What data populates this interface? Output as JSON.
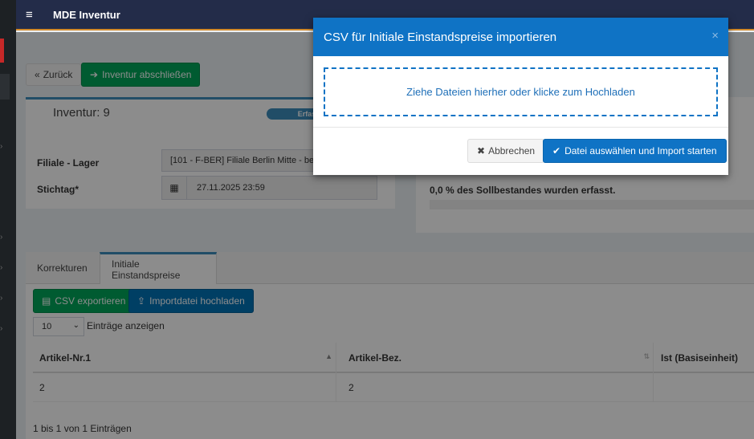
{
  "header": {
    "menu_icon": "hamburger-icon",
    "title": "MDE Inventur"
  },
  "toolbar": {
    "back_label": "Zurück",
    "finish_label": "Inventur abschließen"
  },
  "inventory": {
    "title": "Inventur: 9",
    "status_badge": "Erfas",
    "branch_label": "Filiale - Lager",
    "branch_value": "[101 - F-BER] Filiale Berlin Mitte - be",
    "date_label": "Stichtag*",
    "date_value": "27.11.2025 23:59"
  },
  "progress": {
    "text": "0,0 % des Sollbestandes wurden erfasst.",
    "fraction": 0.0
  },
  "tabs": [
    "Korrekturen",
    "Initiale Einstandspreise"
  ],
  "actions": {
    "export_label": "CSV exportieren",
    "upload_label": "Importdatei hochladen"
  },
  "page_length": {
    "selected": "10",
    "suffix": "Einträge anzeigen"
  },
  "table": {
    "columns": [
      "Artikel-Nr.1",
      "Artikel-Bez.",
      "Ist (Basiseinheit)"
    ],
    "rows": [
      [
        "2",
        "2",
        ""
      ]
    ],
    "info": "1 bis 1 von 1 Einträgen"
  },
  "modal": {
    "title": "CSV für Initiale Einstandspreise importieren",
    "close": "×",
    "dropzone": "Ziehe Dateien hierher oder klicke zum Hochladen",
    "cancel_label": "Abbrechen",
    "confirm_label": "Datei auswählen und Import starten"
  },
  "colors": {
    "header_bg": "#232c49",
    "modal_header": "#0f73c5",
    "green": "#00a65a",
    "blue": "#0073b7"
  }
}
